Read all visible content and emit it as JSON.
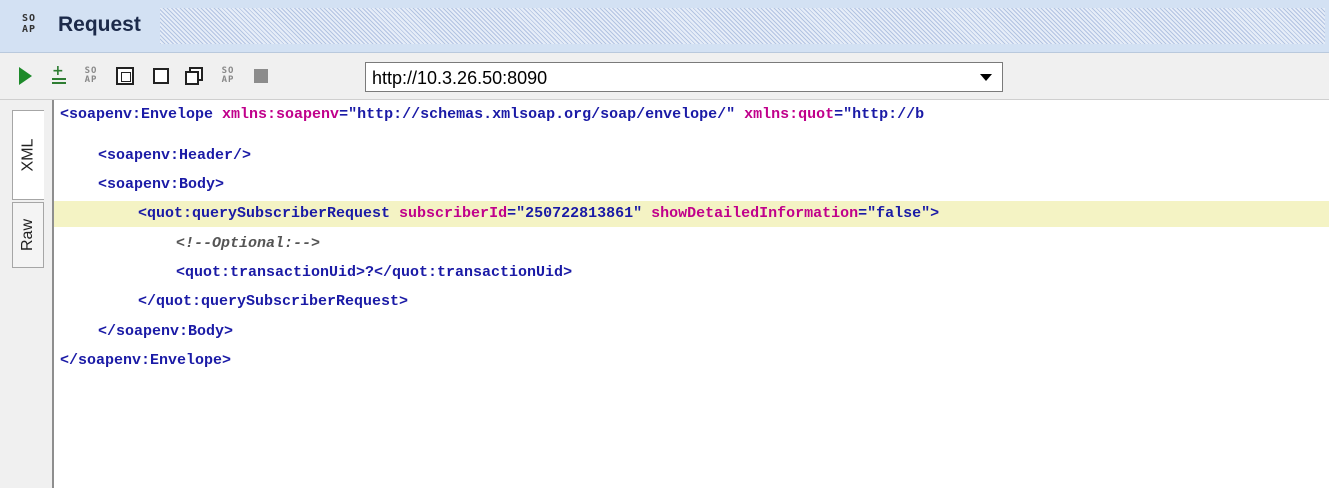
{
  "panel": {
    "title": "Request",
    "icon_text_top": "SO",
    "icon_text_bottom": "AP"
  },
  "toolbar": {
    "mini_icon_top": "SO",
    "mini_icon_bottom": "AP",
    "endpoint_value": "http://10.3.26.50:8090"
  },
  "side_tabs": {
    "xml": "XML",
    "raw": "Raw"
  },
  "xml_lines": {
    "l1": {
      "tag_open": "<soapenv:Envelope",
      "attr1": " xmlns:soapenv",
      "val1": "=\"http://schemas.xmlsoap.org/soap/envelope/\"",
      "attr2": " xmlns:quot",
      "val2": "=\"http://b"
    },
    "l2": "<soapenv:Header/>",
    "l3": "<soapenv:Body>",
    "l4": {
      "tag_open": "<quot:querySubscriberRequest",
      "attr1": " subscriberId",
      "val1": "=\"250722813861\"",
      "attr2": " showDetailedInformation",
      "val2": "=\"false\">"
    },
    "l5": "<!--Optional:-->",
    "l6": "<quot:transactionUid>?</quot:transactionUid>",
    "l7": "</quot:querySubscriberRequest>",
    "l8": "</soapenv:Body>",
    "l9": "</soapenv:Envelope>"
  },
  "colors": {
    "tag": "#1a1aa6",
    "attribute": "#c0008b",
    "highlight_line": "#f4f3c4",
    "run_green": "#1d8a2a"
  }
}
